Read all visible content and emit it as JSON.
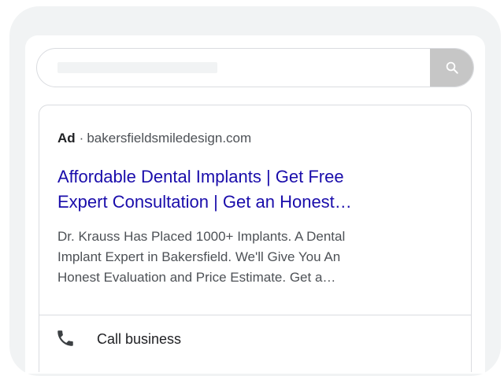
{
  "search": {
    "icon": "search-icon"
  },
  "ad": {
    "badge": "Ad",
    "separator": "·",
    "domain": "bakersfieldsmiledesign.com",
    "headline_line1": "Affordable Dental Implants | Get Free",
    "headline_line2": "Expert Consultation | Get an Honest…",
    "description_line1": "Dr. Krauss Has Placed 1000+ Implants. A Dental",
    "description_line2": "Implant Expert in Bakersfield. We'll Give You An",
    "description_line3": "Honest Evaluation and Price Estimate. Get a…"
  },
  "call": {
    "label": "Call business",
    "icon": "phone-icon"
  },
  "colors": {
    "headline": "#1a0dab",
    "body_text": "#4d5156",
    "search_button": "#c6c6c6"
  }
}
